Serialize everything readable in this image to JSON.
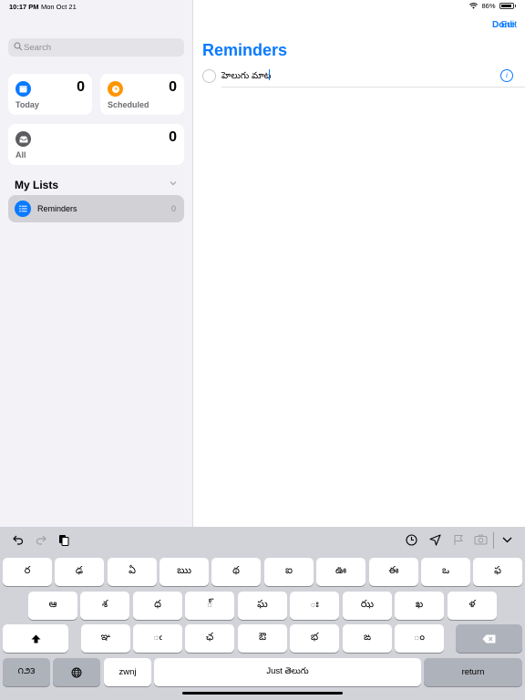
{
  "status_bar": {
    "time": "10:17 PM",
    "date": "Mon Oct 21",
    "battery": "86%"
  },
  "sidebar": {
    "edit_label": "Edit",
    "search_placeholder": "Search",
    "cards": {
      "today": {
        "label": "Today",
        "count": "0",
        "color": "#0a7aff",
        "icon": "calendar-icon"
      },
      "scheduled": {
        "label": "Scheduled",
        "count": "0",
        "color": "#ff9500",
        "icon": "clock-icon"
      },
      "all": {
        "label": "All",
        "count": "0",
        "color": "#5b5b60",
        "icon": "tray-icon"
      }
    },
    "my_lists_header": "My Lists",
    "lists": [
      {
        "name": "Reminders",
        "count": "0",
        "color": "#0a7aff",
        "icon": "list-icon"
      }
    ]
  },
  "detail": {
    "done_label": "Done",
    "title": "Reminders",
    "reminder_text": "హెలుగు మాట"
  },
  "keyboard": {
    "row1": [
      "ర",
      "ఢ",
      "ఏ",
      "ఋ",
      "థ",
      "ఐ",
      "ఊ",
      "ఈ",
      "ఒ",
      "ఫ"
    ],
    "row2": [
      "ఆ",
      "శ",
      "ధ",
      "్",
      "ఘ",
      "ః",
      "ఝ",
      "ఖ",
      "ళ"
    ],
    "row3": [
      "ఞ",
      "ఁ",
      "ఛ",
      "ఔ",
      "భ",
      "ఙ",
      "ం"
    ],
    "row4": {
      "lang": "౧౨౩",
      "zwnj": "zwnj",
      "space": "Just తెలుగు",
      "return": "return"
    }
  }
}
